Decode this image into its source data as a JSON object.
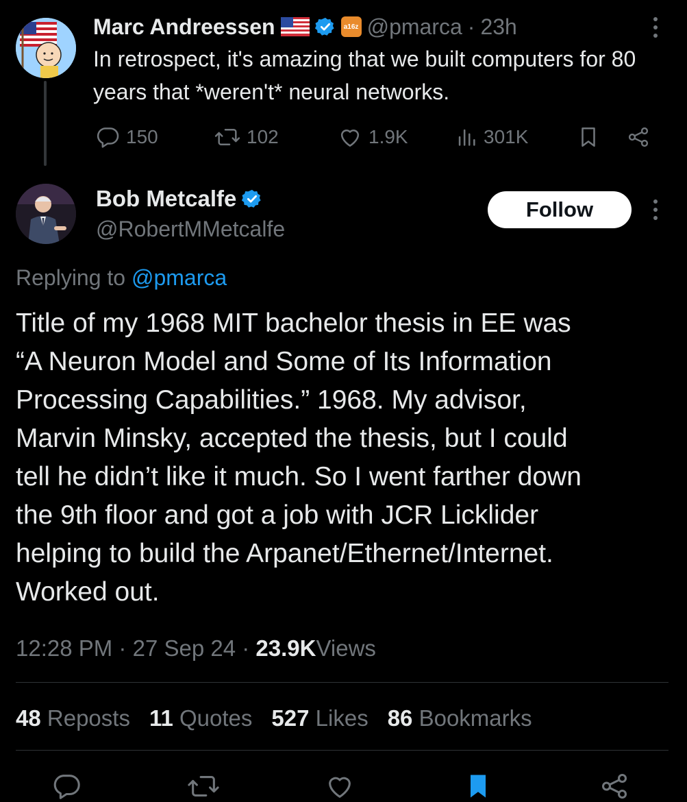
{
  "parent_tweet": {
    "display_name": "Marc Andreessen",
    "flag_icon": "us-flag-icon",
    "verified_icon": "verified-badge-icon",
    "affiliate_badge_text": "a16z",
    "handle": "@pmarca",
    "separator": "·",
    "time_ago": "23h",
    "text": "In retrospect, it's amazing that we built computers for 80 years that *weren't* neural networks.",
    "actions": {
      "replies": "150",
      "reposts": "102",
      "likes": "1.9K",
      "views": "301K"
    }
  },
  "reply_tweet": {
    "display_name": "Bob Metcalfe",
    "handle": "@RobertMMetcalfe",
    "follow_label": "Follow",
    "replying_prefix": "Replying to",
    "replying_handle": "@pmarca",
    "text": "Title of my 1968 MIT bachelor thesis in EE was\n“A Neuron Model and Some of Its Information\nProcessing Capabilities.” 1968. My advisor,\nMarvin Minsky, accepted the thesis, but I could\ntell he didn’t like it much. So I went farther down\nthe 9th floor and got a job with JCR Licklider\nhelping to build the Arpanet/Ethernet/Internet.\nWorked out.",
    "time": "12:28 PM",
    "date": "27 Sep 24",
    "views_count": "23.9K",
    "views_label": "Views",
    "dot": "·",
    "stats": {
      "reposts_count": "48",
      "reposts_label": "Reposts",
      "quotes_count": "11",
      "quotes_label": "Quotes",
      "likes_count": "527",
      "likes_label": "Likes",
      "bookmarks_count": "86",
      "bookmarks_label": "Bookmarks"
    }
  },
  "colors": {
    "background": "#000000",
    "text": "#e7e9ea",
    "muted": "#71767b",
    "link": "#1d9bf0",
    "divider": "#2f3336"
  }
}
